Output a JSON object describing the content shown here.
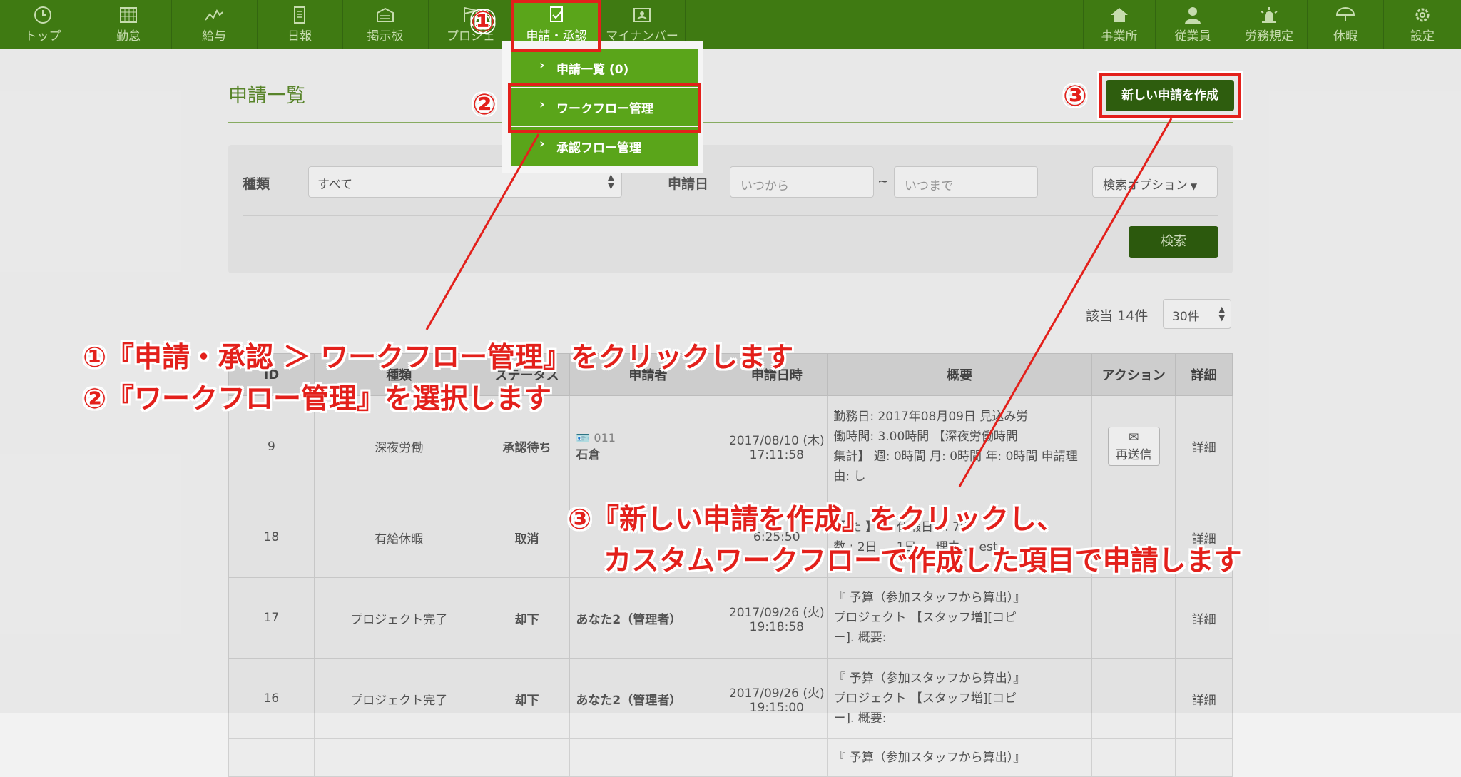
{
  "nav_left": [
    {
      "label": "トップ",
      "icon": "clock-icon"
    },
    {
      "label": "勤怠",
      "icon": "calendar-icon"
    },
    {
      "label": "給与",
      "icon": "chart-icon"
    },
    {
      "label": "日報",
      "icon": "document-icon"
    },
    {
      "label": "掲示板",
      "icon": "board-icon"
    },
    {
      "label": "プロジェ",
      "icon": "flag-icon"
    },
    {
      "label": "申請・承認",
      "icon": "edit-check-icon"
    },
    {
      "label": "マイナンバー",
      "icon": "id-card-icon"
    }
  ],
  "nav_right": [
    {
      "label": "事業所",
      "icon": "home-icon"
    },
    {
      "label": "従業員",
      "icon": "user-icon"
    },
    {
      "label": "労務規定",
      "icon": "siren-icon"
    },
    {
      "label": "休暇",
      "icon": "umbrella-icon"
    },
    {
      "label": "設定",
      "icon": "gear-icon"
    }
  ],
  "dropdown": [
    {
      "label": "申請一覧",
      "count": "(0)"
    },
    {
      "label": "ワークフロー管理"
    },
    {
      "label": "承認フロー管理"
    }
  ],
  "page": {
    "title": "申請一覧",
    "create_button": "新しい申請を作成"
  },
  "search": {
    "type_label": "種類",
    "type_value": "すべて",
    "date_label": "申請日",
    "from_placeholder": "いつから",
    "tilde": "~",
    "to_placeholder": "いつまで",
    "options_button": "検索オプション",
    "search_button": "検索"
  },
  "result": {
    "count": "該当 14件",
    "per_page": "30件"
  },
  "table": {
    "headers": [
      "ID",
      "種類",
      "ステータス",
      "申請者",
      "申請日時",
      "概要",
      "アクション",
      "詳細"
    ],
    "rows": [
      {
        "id": "9",
        "type": "深夜労働",
        "status": "承認待ち",
        "applicant_id": "011",
        "applicant": "石倉",
        "date": "2017/08/10 (木)",
        "time": "17:11:58",
        "summary": [
          "勤務日: 2017年08月09日 見込み労",
          "働時間: 3.00時間 【深夜労働時間",
          "集計】 週: 0時間 月: 0時間 年: 0時間 申請理",
          "由: し"
        ],
        "action": "再送信",
        "detail": "詳細"
      },
      {
        "id": "18",
        "type": "有給休暇",
        "status": "取消",
        "applicant": "",
        "date": "",
        "time": "6:25:50",
        "summary": [
          "【 た 】 ... 休暇日 ... 7年",
          "数 : 2日 ... 1日 ... 理由 ... est"
        ],
        "action": "",
        "detail": "詳細"
      },
      {
        "id": "17",
        "type": "プロジェクト完了",
        "status": "却下",
        "applicant": "あなた2（管理者）",
        "date": "2017/09/26 (火)",
        "time": "19:18:58",
        "summary": [
          "『 予算（参加スタッフから算出）』",
          "プロジェクト 【スタッフ増][コピ",
          "ー]. 概要:"
        ],
        "action": "",
        "detail": "詳細"
      },
      {
        "id": "16",
        "type": "プロジェクト完了",
        "status": "却下",
        "applicant": "あなた2（管理者）",
        "date": "2017/09/26 (火)",
        "time": "19:15:00",
        "summary": [
          "『 予算（参加スタッフから算出）』",
          "プロジェクト 【スタッフ増][コピ",
          "ー]. 概要:"
        ],
        "action": "",
        "detail": "詳細"
      },
      {
        "id": "",
        "type": "",
        "status": "",
        "applicant": "",
        "date": "",
        "time": "",
        "summary": [
          "『 予算（参加スタッフから算出）』"
        ],
        "action": "",
        "detail": ""
      }
    ]
  },
  "annotations": {
    "n1": "①",
    "n2": "②",
    "n3": "③",
    "step12_line1": "①『申請・承認 ＞ ワークフロー管理』をクリックします",
    "step12_line2": "②『ワークフロー管理』を選択します",
    "step3_line1": "③『新しい申請を作成』をクリックし、",
    "step3_line2": "カスタムワークフローで作成した項目で申請します"
  },
  "colors": {
    "nav": "#3f7a12",
    "nav_active": "#5aa51a",
    "annotation": "#e3201b",
    "primary": "#2e5d0e"
  }
}
